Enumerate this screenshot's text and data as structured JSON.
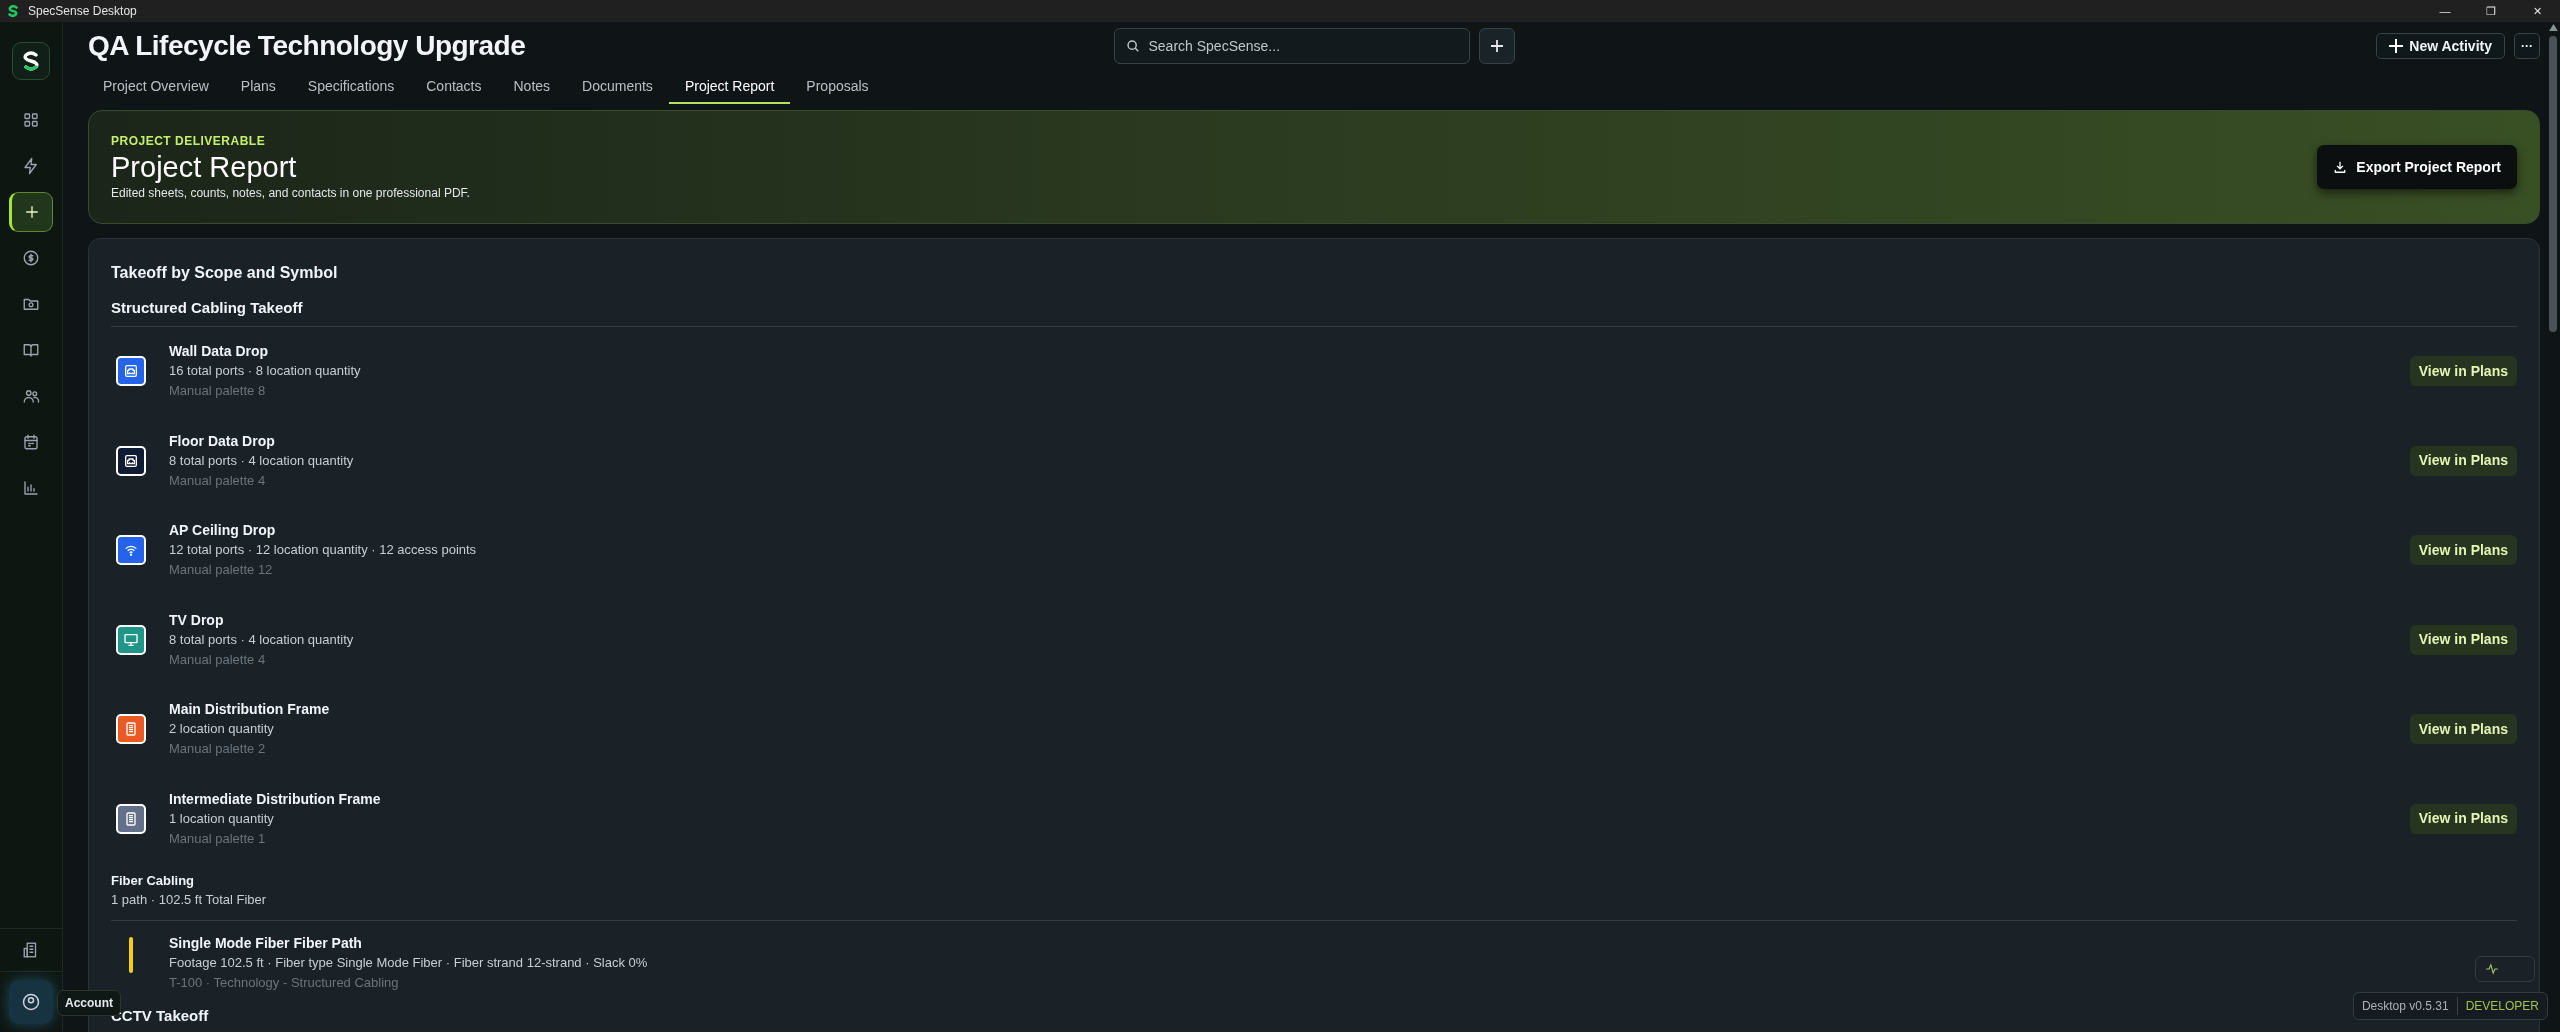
{
  "app_title": "SpecSense Desktop",
  "window_controls": [
    "—",
    "❐",
    "✕"
  ],
  "sidebar": {
    "items": [
      {
        "selected": false
      },
      {
        "selected": false
      },
      {
        "selected": true
      },
      {
        "selected": false
      },
      {
        "selected": false
      },
      {
        "selected": false
      },
      {
        "selected": false
      },
      {
        "selected": false
      },
      {
        "selected": false
      }
    ],
    "tooltip": "Account"
  },
  "header": {
    "title": "QA Lifecycle Technology Upgrade",
    "search": {
      "placeholder": "Search SpecSense..."
    },
    "new_activity": "New Activity",
    "more": "···"
  },
  "tabs": [
    {
      "label": "Project Overview",
      "selected": false
    },
    {
      "label": "Plans",
      "selected": false
    },
    {
      "label": "Specifications",
      "selected": false
    },
    {
      "label": "Contacts",
      "selected": false
    },
    {
      "label": "Notes",
      "selected": false
    },
    {
      "label": "Documents",
      "selected": false
    },
    {
      "label": "Project Report",
      "selected": true
    },
    {
      "label": "Proposals",
      "selected": false
    }
  ],
  "banner": {
    "eyebrow": "PROJECT DELIVERABLE",
    "title": "Project Report",
    "subtitle": "Edited sheets, counts, notes, and contacts in one professional PDF.",
    "export_button": "Export Project Report"
  },
  "report": {
    "title": "Takeoff by Scope and Symbol",
    "sections": [
      {
        "kind": "symbols",
        "title": "Structured Cabling Takeoff",
        "items": [
          {
            "kind": "jack",
            "color": "#2563eb",
            "name": "Wall Data Drop",
            "details": "16 total ports · 8 location quantity",
            "meta": "Manual palette 8",
            "action": "View in Plans"
          },
          {
            "kind": "jack",
            "color": "#111c33",
            "name": "Floor Data Drop",
            "details": "8 total ports · 4 location quantity",
            "meta": "Manual palette 4",
            "action": "View in Plans"
          },
          {
            "kind": "wifi",
            "color": "#2563eb",
            "name": "AP Ceiling Drop",
            "details": "12 total ports · 12 location quantity · 12 access points",
            "meta": "Manual palette 12",
            "action": "View in Plans"
          },
          {
            "kind": "monitor",
            "color": "#1f9688",
            "name": "TV Drop",
            "details": "8 total ports · 4 location quantity",
            "meta": "Manual palette 4",
            "action": "View in Plans"
          },
          {
            "kind": "rack",
            "color": "#ea5a24",
            "name": "Main Distribution Frame",
            "details": "2 location quantity",
            "meta": "Manual palette 2",
            "action": "View in Plans"
          },
          {
            "kind": "rack",
            "color": "#64708a",
            "name": "Intermediate Distribution Frame",
            "details": "1 location quantity",
            "meta": "Manual palette 1",
            "action": "View in Plans"
          }
        ]
      },
      {
        "kind": "paths",
        "title": "Fiber Cabling",
        "summary": "1 path · 102.5 ft Total Fiber",
        "items": [
          {
            "color": "#facc15",
            "name": "Single Mode Fiber Fiber Path",
            "details": "Footage 102.5 ft · Fiber type Single Mode Fiber · Fiber strand 12-strand · Slack 0%",
            "meta": "T-100 · Technology - Structured Cabling"
          }
        ]
      },
      {
        "kind": "symbols",
        "title": "CCTV Takeoff"
      }
    ]
  },
  "version": {
    "label": "Desktop v0.5.31",
    "channel": "DEVELOPER"
  }
}
